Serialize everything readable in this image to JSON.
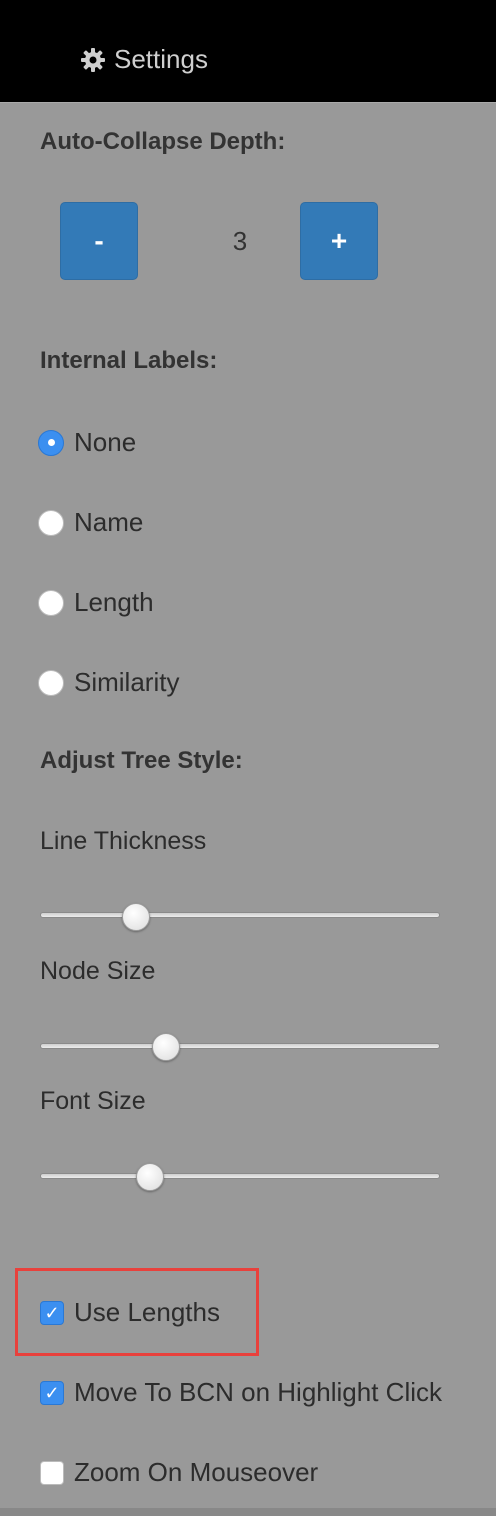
{
  "header": {
    "title": "Settings",
    "icon": "gear-icon"
  },
  "auto_collapse": {
    "heading": "Auto-Collapse Depth:",
    "decrement_label": "-",
    "increment_label": "+",
    "value": "3"
  },
  "internal_labels": {
    "heading": "Internal Labels:",
    "options": [
      {
        "label": "None",
        "selected": true
      },
      {
        "label": "Name",
        "selected": false
      },
      {
        "label": "Length",
        "selected": false
      },
      {
        "label": "Similarity",
        "selected": false
      }
    ]
  },
  "tree_style": {
    "heading": "Adjust Tree Style:",
    "sliders": [
      {
        "label": "Line Thickness",
        "value_fraction": 0.24
      },
      {
        "label": "Node Size",
        "value_fraction": 0.315
      },
      {
        "label": "Font Size",
        "value_fraction": 0.275
      }
    ]
  },
  "options": {
    "checkboxes": [
      {
        "label": "Use Lengths",
        "checked": true
      },
      {
        "label": "Move To BCN on Highlight Click",
        "checked": true
      },
      {
        "label": "Zoom On Mouseover",
        "checked": false
      }
    ]
  },
  "colors": {
    "panel_background": "#999999",
    "header_background": "#000000",
    "button_blue": "#337ab7",
    "accent_blue": "#3b8ff0",
    "highlight_red": "#e8413c"
  }
}
